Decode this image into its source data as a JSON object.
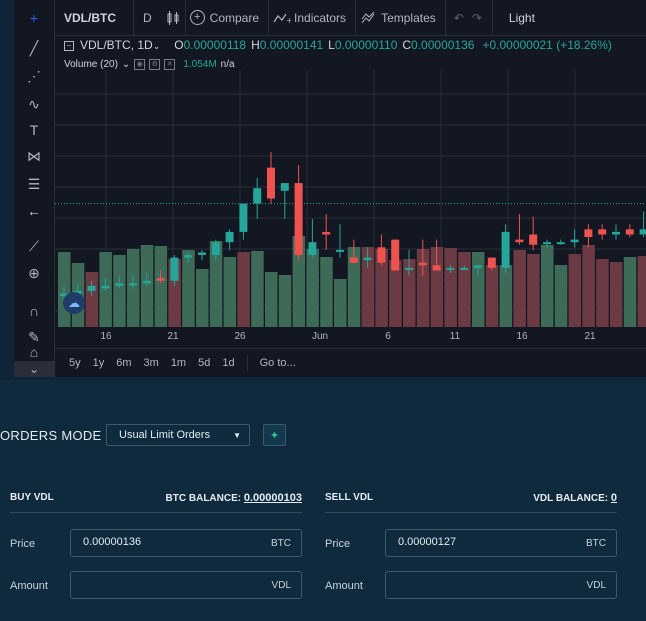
{
  "toolbar": {
    "tools": [
      {
        "icon": "crosshair-icon",
        "glyph": "+"
      },
      {
        "icon": "trend-line-icon",
        "glyph": "╱"
      },
      {
        "icon": "pitchfork-icon",
        "glyph": "⋰"
      },
      {
        "icon": "brush-icon",
        "glyph": "∿"
      },
      {
        "icon": "text-icon",
        "glyph": "T"
      },
      {
        "icon": "pattern-icon",
        "glyph": "⋈"
      },
      {
        "icon": "fib-retracement-icon",
        "glyph": "☰"
      },
      {
        "icon": "back-arrow-icon",
        "glyph": "←"
      },
      {
        "icon": "ruler-icon",
        "glyph": "⟋"
      },
      {
        "icon": "zoom-in-icon",
        "glyph": "⊕"
      },
      {
        "icon": "magnet-icon",
        "glyph": "∩"
      },
      {
        "icon": "lock-draw-icon",
        "glyph": "✎"
      },
      {
        "icon": "lock-icon",
        "glyph": "⌂"
      }
    ],
    "scroll_glyph": "⌄"
  },
  "topbar": {
    "symbol": "VDL/BTC",
    "interval": "D",
    "bar_style_icon": "candles-icon",
    "compare": "Compare",
    "indicators": "Indicators",
    "templates": "Templates",
    "undo_glyph": "↶",
    "redo_glyph": "↷",
    "theme": "Light"
  },
  "legend": {
    "title": "VDL/BTC, 1D",
    "o_label": "O",
    "o": "0.00000118",
    "h_label": "H",
    "h": "0.00000141",
    "l_label": "L",
    "l": "0.00000110",
    "c_label": "C",
    "c": "0.00000136",
    "change": "+0.00000021 (+18.26%)"
  },
  "volume_legend": {
    "label": "Volume (20)",
    "value": "1.054M",
    "ma": "n/a"
  },
  "xaxis": {
    "ticks": [
      "16",
      "21",
      "26",
      "Jun",
      "6",
      "11",
      "16",
      "21"
    ]
  },
  "rangebar": {
    "ranges": [
      "5y",
      "1y",
      "6m",
      "3m",
      "1m",
      "5d",
      "1d"
    ],
    "goto": "Go to..."
  },
  "colors": {
    "up": "#26a69a",
    "down": "#ef5350",
    "up_volume": "#3d6b57",
    "down_volume": "#6b3a43",
    "accent_green": "#35c48d"
  },
  "chart_data": {
    "type": "candlestick",
    "price_range": [
      7e-07,
      1.7e-06
    ],
    "candles": [
      {
        "o": 8.2e-07,
        "h": 8.6e-07,
        "l": 8e-07,
        "c": 8.3e-07
      },
      {
        "o": 8.3e-07,
        "h": 8.7e-07,
        "l": 8.1e-07,
        "c": 8.4e-07
      },
      {
        "o": 8.4e-07,
        "h": 8.8e-07,
        "l": 8.2e-07,
        "c": 8.6e-07
      },
      {
        "o": 8.5e-07,
        "h": 8.9e-07,
        "l": 8.4e-07,
        "c": 8.6e-07
      },
      {
        "o": 8.6e-07,
        "h": 9e-07,
        "l": 8.5e-07,
        "c": 8.7e-07
      },
      {
        "o": 8.7e-07,
        "h": 9e-07,
        "l": 8.5e-07,
        "c": 8.7e-07
      },
      {
        "o": 8.7e-07,
        "h": 9.1e-07,
        "l": 8.6e-07,
        "c": 8.8e-07
      },
      {
        "o": 8.9e-07,
        "h": 9.2e-07,
        "l": 8.7e-07,
        "c": 8.8e-07
      },
      {
        "o": 8.8e-07,
        "h": 9.8e-07,
        "l": 8.6e-07,
        "c": 9.7e-07
      },
      {
        "o": 9.7e-07,
        "h": 9.9e-07,
        "l": 9.5e-07,
        "c": 9.8e-07
      },
      {
        "o": 9.8e-07,
        "h": 1e-06,
        "l": 9.6e-07,
        "c": 9.9e-07
      },
      {
        "o": 9.8e-07,
        "h": 1.04e-06,
        "l": 9.6e-07,
        "c": 1.03e-06
      },
      {
        "o": 1.03e-06,
        "h": 1.08e-06,
        "l": 1e-06,
        "c": 1.07e-06
      },
      {
        "o": 1.07e-06,
        "h": 1.18e-06,
        "l": 1.04e-06,
        "c": 1.18e-06
      },
      {
        "o": 1.18e-06,
        "h": 1.28e-06,
        "l": 1.12e-06,
        "c": 1.24e-06
      },
      {
        "o": 1.32e-06,
        "h": 1.38e-06,
        "l": 1.18e-06,
        "c": 1.2e-06
      },
      {
        "o": 1.23e-06,
        "h": 1.26e-06,
        "l": 1.12e-06,
        "c": 1.26e-06
      },
      {
        "o": 1.26e-06,
        "h": 1.33e-06,
        "l": 9.6e-07,
        "c": 9.8e-07
      },
      {
        "o": 9.8e-07,
        "h": 1.12e-06,
        "l": 9.7e-07,
        "c": 1.03e-06
      },
      {
        "o": 1.07e-06,
        "h": 1.14e-06,
        "l": 1e-06,
        "c": 1.06e-06
      },
      {
        "o": 1e-06,
        "h": 1.1e-06,
        "l": 9.7e-07,
        "c": 1e-06
      },
      {
        "o": 9.7e-07,
        "h": 1.04e-06,
        "l": 9.5e-07,
        "c": 9.5e-07
      },
      {
        "o": 9.6e-07,
        "h": 1.01e-06,
        "l": 9.3e-07,
        "c": 9.7e-07
      },
      {
        "o": 1.01e-06,
        "h": 1.06e-06,
        "l": 9.4e-07,
        "c": 9.5e-07
      },
      {
        "o": 1.04e-06,
        "h": 1.04e-06,
        "l": 9.2e-07,
        "c": 9.2e-07
      },
      {
        "o": 9.3e-07,
        "h": 1e-06,
        "l": 9e-07,
        "c": 9.3e-07
      },
      {
        "o": 9.5e-07,
        "h": 1.04e-06,
        "l": 9e-07,
        "c": 9.4e-07
      },
      {
        "o": 9.4e-07,
        "h": 1.04e-06,
        "l": 9.2e-07,
        "c": 9.2e-07
      },
      {
        "o": 9.3e-07,
        "h": 9.4e-07,
        "l": 9.1e-07,
        "c": 9.3e-07
      },
      {
        "o": 9.3e-07,
        "h": 9.4e-07,
        "l": 9.2e-07,
        "c": 9.3e-07
      },
      {
        "o": 9.3e-07,
        "h": 9.4e-07,
        "l": 9e-07,
        "c": 9.4e-07
      },
      {
        "o": 9.7e-07,
        "h": 9.7e-07,
        "l": 9.2e-07,
        "c": 9.3e-07
      },
      {
        "o": 9.3e-07,
        "h": 1.1e-06,
        "l": 9.1e-07,
        "c": 1.07e-06
      },
      {
        "o": 1.04e-06,
        "h": 1.14e-06,
        "l": 1.02e-06,
        "c": 1.03e-06
      },
      {
        "o": 1.06e-06,
        "h": 1.13e-06,
        "l": 1e-06,
        "c": 1.02e-06
      },
      {
        "o": 1.03e-06,
        "h": 1.04e-06,
        "l": 1.01e-06,
        "c": 1.03e-06
      },
      {
        "o": 1.03e-06,
        "h": 1.04e-06,
        "l": 1.02e-06,
        "c": 1.03e-06
      },
      {
        "o": 1.03e-06,
        "h": 1.08e-06,
        "l": 1.01e-06,
        "c": 1.04e-06
      },
      {
        "o": 1.08e-06,
        "h": 1.1e-06,
        "l": 1.01e-06,
        "c": 1.05e-06
      },
      {
        "o": 1.08e-06,
        "h": 1.1e-06,
        "l": 1.04e-06,
        "c": 1.06e-06
      },
      {
        "o": 1.06e-06,
        "h": 1.1e-06,
        "l": 1.04e-06,
        "c": 1.07e-06
      },
      {
        "o": 1.08e-06,
        "h": 1.1e-06,
        "l": 1.05e-06,
        "c": 1.06e-06
      },
      {
        "o": 1.06e-06,
        "h": 1.15e-06,
        "l": 1.05e-06,
        "c": 1.08e-06
      },
      {
        "o": 1.08e-06,
        "h": 1.12e-06,
        "l": 1.01e-06,
        "c": 1.03e-06
      },
      {
        "o": 1.08e-06,
        "h": 1.16e-06,
        "l": 1.07e-06,
        "c": 1.13e-06
      },
      {
        "o": 1.13e-06,
        "h": 1.18e-06,
        "l": 1.1e-06,
        "c": 1.12e-06
      }
    ],
    "volumes": [
      {
        "v": 0.75,
        "up": true
      },
      {
        "v": 0.64,
        "up": true
      },
      {
        "v": 0.55,
        "up": false
      },
      {
        "v": 0.75,
        "up": true
      },
      {
        "v": 0.72,
        "up": true
      },
      {
        "v": 0.78,
        "up": true
      },
      {
        "v": 0.82,
        "up": true
      },
      {
        "v": 0.81,
        "up": true
      },
      {
        "v": 0.68,
        "up": false
      },
      {
        "v": 0.77,
        "up": true
      },
      {
        "v": 0.58,
        "up": true
      },
      {
        "v": 0.86,
        "up": true
      },
      {
        "v": 0.7,
        "up": true
      },
      {
        "v": 0.75,
        "up": false
      },
      {
        "v": 0.76,
        "up": true
      },
      {
        "v": 0.55,
        "up": true
      },
      {
        "v": 0.52,
        "up": true
      },
      {
        "v": 0.91,
        "up": true
      },
      {
        "v": 0.78,
        "up": true
      },
      {
        "v": 0.7,
        "up": true
      },
      {
        "v": 0.48,
        "up": true
      },
      {
        "v": 0.8,
        "up": true
      },
      {
        "v": 0.8,
        "up": false
      },
      {
        "v": 0.78,
        "up": false
      },
      {
        "v": 0.67,
        "up": false
      },
      {
        "v": 0.68,
        "up": false
      },
      {
        "v": 0.78,
        "up": false
      },
      {
        "v": 0.8,
        "up": false
      },
      {
        "v": 0.79,
        "up": false
      },
      {
        "v": 0.75,
        "up": false
      },
      {
        "v": 0.75,
        "up": true
      },
      {
        "v": 0.62,
        "up": false
      },
      {
        "v": 0.62,
        "up": true
      },
      {
        "v": 0.77,
        "up": false
      },
      {
        "v": 0.73,
        "up": false
      },
      {
        "v": 0.82,
        "up": true
      },
      {
        "v": 0.62,
        "up": true
      },
      {
        "v": 0.73,
        "up": false
      },
      {
        "v": 0.82,
        "up": false
      },
      {
        "v": 0.68,
        "up": false
      },
      {
        "v": 0.65,
        "up": false
      },
      {
        "v": 0.7,
        "up": true
      },
      {
        "v": 0.71,
        "up": false
      },
      {
        "v": 0.75,
        "up": true
      },
      {
        "v": 0.72,
        "up": true
      },
      {
        "v": 0.72,
        "up": true
      }
    ],
    "reference_line": 1.18e-06
  },
  "orders": {
    "mode_label": "ORDERS MODE",
    "mode_value": "Usual Limit Orders",
    "chevron": "▼",
    "action_glyph": "✦",
    "buy": {
      "title": "BUY VDL",
      "balance_label": "BTC BALANCE:",
      "balance_value": "0.00000103",
      "price_label": "Price",
      "price_value": "0.00000136",
      "price_unit": "BTC",
      "amount_label": "Amount",
      "amount_value": "",
      "amount_unit": "VDL"
    },
    "sell": {
      "title": "SELL VDL",
      "balance_label": "VDL BALANCE:",
      "balance_value": "0",
      "price_label": "Price",
      "price_value": "0.00000127",
      "price_unit": "BTC",
      "amount_label": "Amount",
      "amount_value": "",
      "amount_unit": "VDL"
    }
  }
}
